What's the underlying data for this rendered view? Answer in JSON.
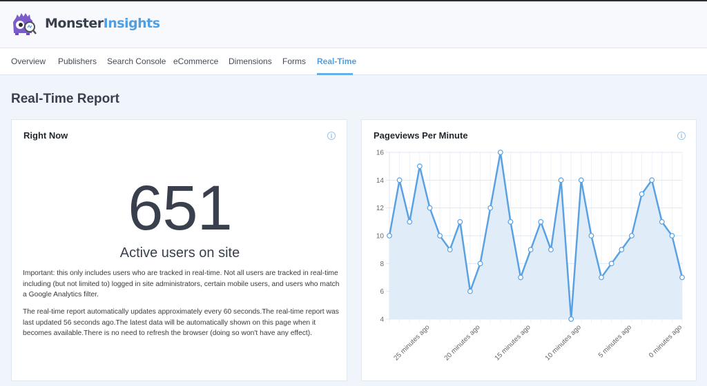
{
  "app": {
    "brand_part1": "Monster",
    "brand_part2": "Insights",
    "logo_icon": "monster-mascot-with-magnifier"
  },
  "nav": {
    "items": [
      {
        "label": "Overview",
        "active": false
      },
      {
        "label": "Publishers",
        "active": false
      },
      {
        "label": "Search Console",
        "active": false
      },
      {
        "label": "eCommerce",
        "active": false
      },
      {
        "label": "Dimensions",
        "active": false
      },
      {
        "label": "Forms",
        "active": false
      },
      {
        "label": "Real-Time",
        "active": true
      }
    ]
  },
  "page": {
    "title": "Real-Time Report"
  },
  "right_now": {
    "title": "Right Now",
    "info_icon": "info-circle",
    "active_users": "651",
    "active_label": "Active users on site",
    "note1": "Important: this only includes users who are tracked in real-time. Not all users are tracked in real-time including (but not limited to) logged in site administrators, certain mobile users, and users who match a Google Analytics filter.",
    "note2": "The real-time report automatically updates approximately every 60 seconds.The real-time report was last updated 56 seconds ago.The latest data will be automatically shown on this page when it becomes available.There is no need to refresh the browser (doing so won't have any effect)."
  },
  "pageviews": {
    "title": "Pageviews Per Minute",
    "info_icon": "info-circle"
  },
  "colors": {
    "accent": "#509fe2",
    "line": "#5aa1e3",
    "fill": "#ddebf8",
    "text": "#393f4c"
  },
  "chart_data": {
    "type": "area",
    "title": "Pageviews Per Minute",
    "xlabel": "",
    "ylabel": "",
    "ylim": [
      4,
      16
    ],
    "yticks": [
      4,
      6,
      8,
      10,
      12,
      14,
      16
    ],
    "grid": true,
    "legend": "none",
    "x_tick_labels": [
      {
        "index": 4,
        "label": "25 minutes ago"
      },
      {
        "index": 9,
        "label": "20 minutes ago"
      },
      {
        "index": 14,
        "label": "15 minutes ago"
      },
      {
        "index": 19,
        "label": "10 minutes ago"
      },
      {
        "index": 24,
        "label": "5 minutes ago"
      },
      {
        "index": 29,
        "label": "0 minutes ago"
      }
    ],
    "series": [
      {
        "name": "Pageviews",
        "values": [
          10,
          14,
          11,
          15,
          12,
          10,
          9,
          11,
          6,
          8,
          12,
          16,
          11,
          7,
          9,
          11,
          9,
          14,
          4,
          14,
          10,
          7,
          8,
          9,
          10,
          13,
          14,
          11,
          10,
          7
        ]
      }
    ]
  }
}
